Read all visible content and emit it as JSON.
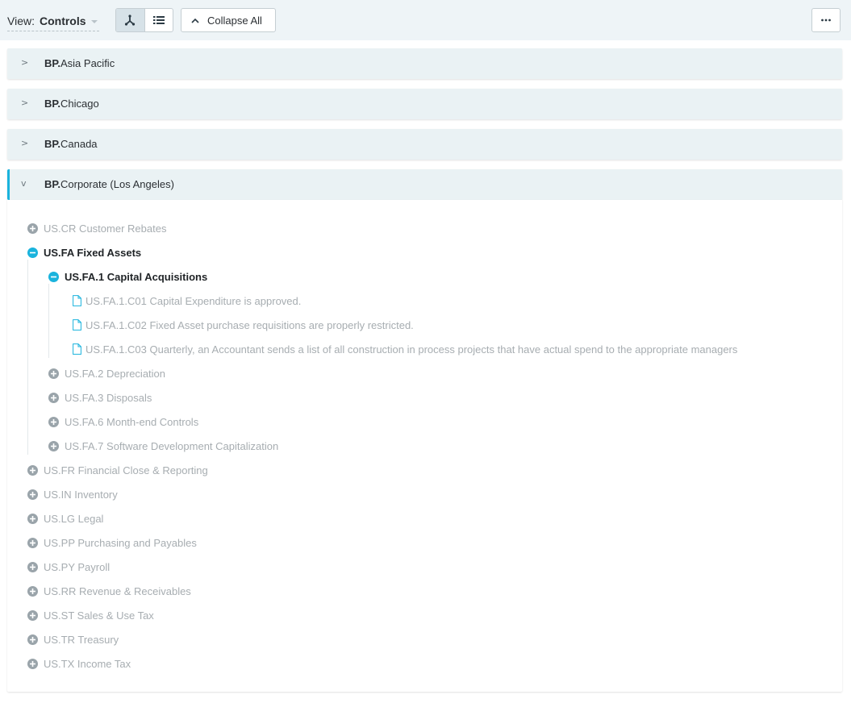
{
  "toolbar": {
    "view_label": "View:",
    "view_value": "Controls",
    "collapse_label": "Collapse All",
    "more_label": "···"
  },
  "groups": [
    {
      "prefix": "BP.",
      "name": "Asia Pacific",
      "arrow": ">"
    },
    {
      "prefix": "BP.",
      "name": "Chicago",
      "arrow": ">"
    },
    {
      "prefix": "BP.",
      "name": "Canada",
      "arrow": ">"
    },
    {
      "prefix": "BP.",
      "name": "Corporate (Los Angeles)",
      "arrow": "v"
    }
  ],
  "tree": {
    "items": [
      "US.CR Customer Rebates",
      "US.FA Fixed Assets",
      "US.FA.1 Capital Acquisitions",
      "US.FA.1.C01 Capital Expenditure is approved.",
      "US.FA.1.C02 Fixed Asset purchase requisitions are properly restricted.",
      "US.FA.1.C03 Quarterly, an Accountant sends a list of all construction in process projects that have actual spend to the appropriate managers",
      "US.FA.2 Depreciation",
      "US.FA.3 Disposals",
      "US.FA.6 Month-end Controls",
      "US.FA.7 Software Development Capitalization",
      "US.FR Financial Close & Reporting",
      "US.IN Inventory",
      "US.LG Legal",
      "US.PP Purchasing and Payables",
      "US.PY Payroll",
      "US.RR Revenue & Receivables",
      "US.ST Sales & Use Tax",
      "US.TR Treasury",
      "US.TX Income Tax"
    ]
  },
  "colors": {
    "accent": "#1ab3dd",
    "muted_icon": "#9aa4aa",
    "panel_bg": "#eaf2f4"
  }
}
